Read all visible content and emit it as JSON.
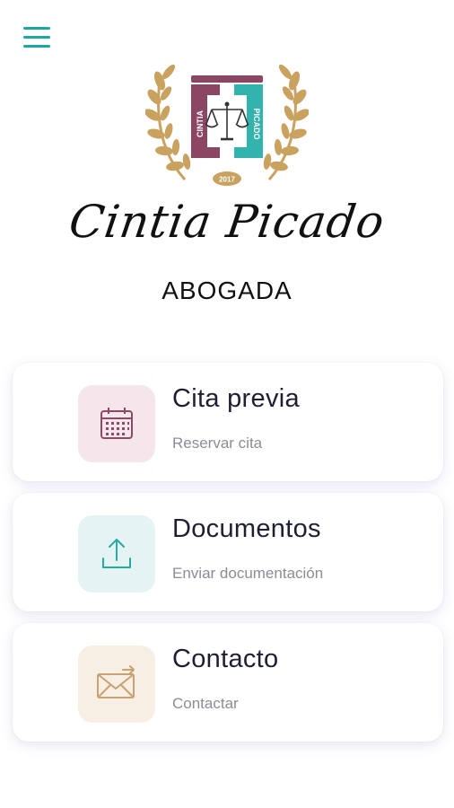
{
  "header": {
    "menu_icon": "hamburger-menu-icon"
  },
  "brand": {
    "logo_name_left": "CINTIA",
    "logo_name_right": "PICADO",
    "logo_year": "2017",
    "name": "Cintia Picado",
    "subtitle": "ABOGADA"
  },
  "cards": [
    {
      "title": "Cita previa",
      "subtitle": "Reservar cita",
      "icon": "calendar-icon",
      "icon_bg": "#f5e6ec",
      "icon_color": "#8c4a68"
    },
    {
      "title": "Documentos",
      "subtitle": "Enviar documentación",
      "icon": "upload-icon",
      "icon_bg": "#e4f4f3",
      "icon_color": "#2aa9a4"
    },
    {
      "title": "Contacto",
      "subtitle": "Contactar",
      "icon": "mail-icon",
      "icon_bg": "#f7efe3",
      "icon_color": "#c8a272"
    }
  ],
  "colors": {
    "accent": "#1aa8a4",
    "logo_maroon": "#8a4662",
    "logo_teal": "#33b3ad",
    "laurel_gold": "#c9a25f"
  }
}
